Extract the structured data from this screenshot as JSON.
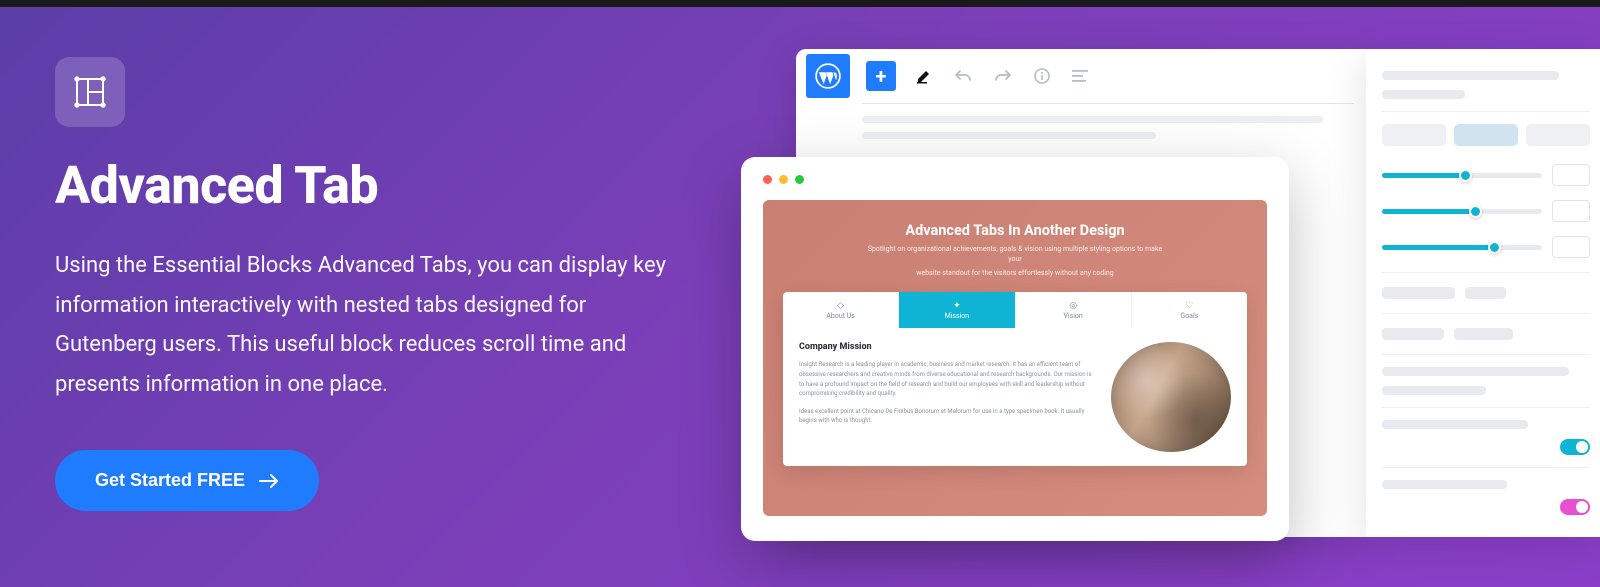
{
  "hero": {
    "title": "Advanced Tab",
    "description": "Using the Essential Blocks Advanced Tabs, you can display key information interactively with nested tabs designed for Gutenberg users. This useful block reduces scroll time and presents information in one place.",
    "cta_label": "Get Started FREE"
  },
  "editor": {
    "canvas_title": "Advanced Tabs In Another Design",
    "canvas_sub1": "Spotlight on organizational achievements, goals & vision using multiple styling options to make your",
    "canvas_sub2": "website standout for the visitors effortlessly without any coding",
    "tabs": {
      "t1": {
        "icon": "◇",
        "label": "About Us"
      },
      "t2": {
        "icon": "✦",
        "label": "Mission"
      },
      "t3": {
        "icon": "◎",
        "label": "Vision"
      },
      "t4": {
        "icon": "♡",
        "label": "Goals"
      }
    },
    "body_heading": "Company Mission",
    "body_p1": "Insight Research is a leading player in academic, business and market research. It has an efficient team of obsessive researchers and creative minds from diverse educational and research backgrounds. Our mission is to have a profound impact on the field of research and build our employees with skill and leadership without compromising credibility and quality.",
    "body_p2": "Ideas excellent point at Chicano De Finibus Bonorum et Malorum for use in a type specimen book. It usually begins with who is thought."
  },
  "sidebar": {
    "slider1_pct": 52,
    "slider2_pct": 58,
    "slider3_pct": 70
  }
}
